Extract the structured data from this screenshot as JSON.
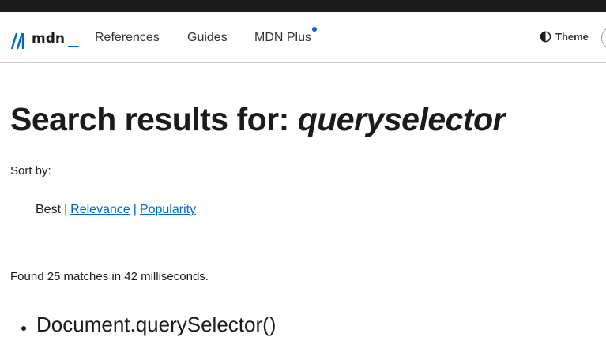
{
  "nav": {
    "logo_text": "mdn",
    "items": [
      "References",
      "Guides",
      "MDN Plus"
    ],
    "theme_label": "Theme"
  },
  "search": {
    "title_prefix": "Search results for: ",
    "query": "queryselector",
    "sort_label": "Sort by:",
    "sort_options": {
      "best": "Best",
      "relevance": "Relevance",
      "popularity": "Popularity"
    },
    "summary": "Found 25 matches in 42 milliseconds.",
    "results": [
      {
        "title": "Document.querySelector()"
      }
    ]
  },
  "colors": {
    "accent": "#0069c2",
    "text": "#1b1b1b",
    "topbar": "#1b1b1b"
  }
}
